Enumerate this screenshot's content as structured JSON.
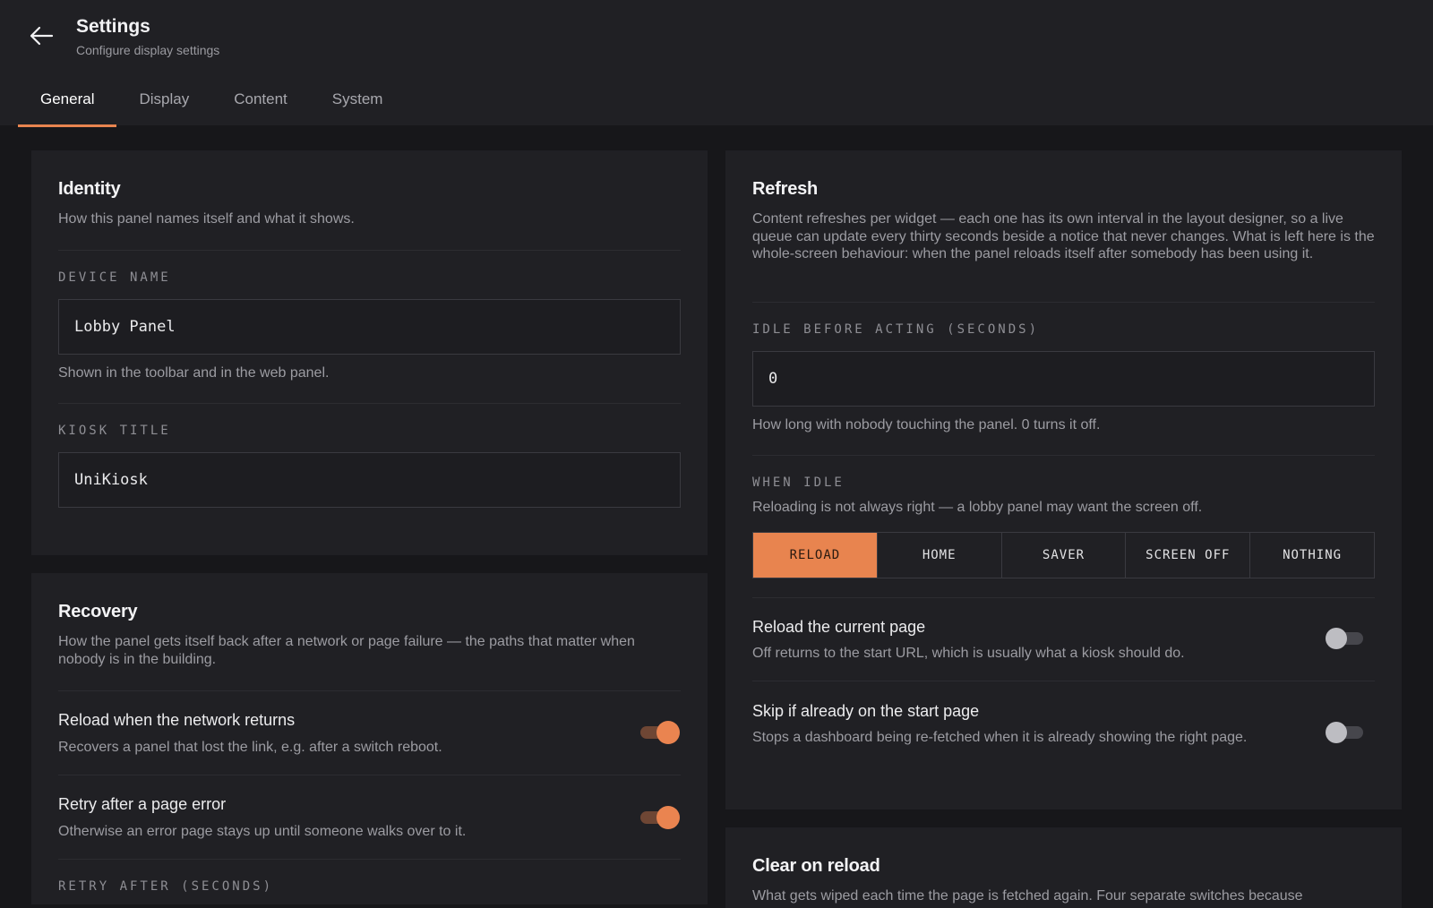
{
  "header": {
    "title": "Settings",
    "subtitle": "Configure display settings",
    "tabs": [
      {
        "label": "General",
        "active": true
      },
      {
        "label": "Display",
        "active": false
      },
      {
        "label": "Content",
        "active": false
      },
      {
        "label": "System",
        "active": false
      }
    ]
  },
  "identity": {
    "title": "Identity",
    "desc": "How this panel names itself and what it shows.",
    "device_name_label": "DEVICE NAME",
    "device_name_value": "Lobby Panel",
    "device_name_helper": "Shown in the toolbar and in the web panel.",
    "kiosk_title_label": "KIOSK TITLE",
    "kiosk_title_value": "UniKiosk"
  },
  "recovery": {
    "title": "Recovery",
    "desc": "How the panel gets itself back after a network or page failure — the paths that matter when nobody is in the building.",
    "rows": [
      {
        "title": "Reload when the network returns",
        "desc": "Recovers a panel that lost the link, e.g. after a switch reboot.",
        "on": true
      },
      {
        "title": "Retry after a page error",
        "desc": "Otherwise an error page stays up until someone walks over to it.",
        "on": true
      }
    ],
    "retry_label": "RETRY AFTER (SECONDS)"
  },
  "refresh": {
    "title": "Refresh",
    "desc": "Content refreshes per widget — each one has its own interval in the layout designer, so a live queue can update every thirty seconds beside a notice that never changes. What is left here is the whole-screen behaviour: when the panel reloads itself after somebody has been using it.",
    "idle_label": "IDLE BEFORE ACTING (SECONDS)",
    "idle_value": "0",
    "idle_helper": "How long with nobody touching the panel. 0 turns it off.",
    "when_idle_label": "WHEN IDLE",
    "when_idle_desc": "Reloading is not always right — a lobby panel may want the screen off.",
    "options": [
      "RELOAD",
      "HOME",
      "SAVER",
      "SCREEN OFF",
      "NOTHING"
    ],
    "selected_option": "RELOAD",
    "rows": [
      {
        "title": "Reload the current page",
        "desc": "Off returns to the start URL, which is usually what a kiosk should do.",
        "on": false
      },
      {
        "title": "Skip if already on the start page",
        "desc": "Stops a dashboard being re-fetched when it is already showing the right page.",
        "on": false
      }
    ]
  },
  "clear_on_reload": {
    "title": "Clear on reload",
    "desc": "What gets wiped each time the page is fetched again. Four separate switches because"
  },
  "colors": {
    "accent": "#e8844f",
    "background": "#17171a",
    "card": "#202024"
  },
  "icons": {
    "back": "arrow-left-icon"
  }
}
